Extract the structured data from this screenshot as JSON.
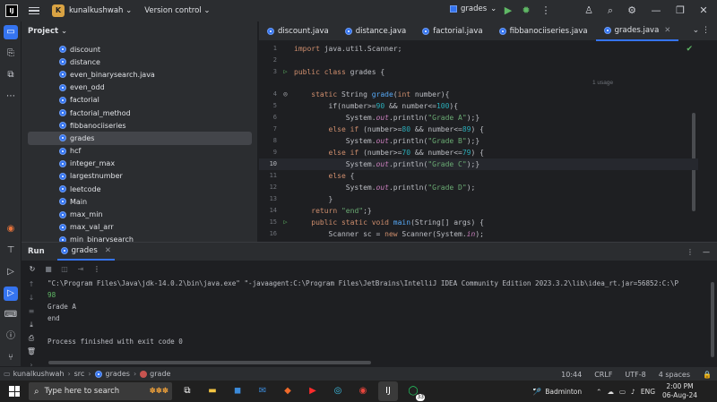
{
  "titlebar": {
    "app_logo": "IJ",
    "project_badge": "K",
    "project_name": "kunalkushwah",
    "version_control": "Version control",
    "run_config": "grades",
    "icons": [
      "menu-icon",
      "run-icon",
      "debug-icon",
      "more-icon",
      "add-user-icon",
      "search-icon",
      "settings-icon",
      "minimize-icon",
      "restore-icon",
      "close-icon"
    ]
  },
  "project": {
    "title": "Project",
    "items": [
      "discount",
      "distance",
      "even_binarysearch.java",
      "even_odd",
      "factorial",
      "factorial_method",
      "fibbanociiseries",
      "grades",
      "hcf",
      "integer_max",
      "largestnumber",
      "leetcode",
      "Main",
      "max_min",
      "max_val_arr",
      "min_binarysearch"
    ],
    "selected_index": 7
  },
  "tabs": [
    {
      "label": "discount.java"
    },
    {
      "label": "distance.java"
    },
    {
      "label": "factorial.java"
    },
    {
      "label": "fibbanociiseries.java"
    },
    {
      "label": "grades.java",
      "active": true
    }
  ],
  "editor": {
    "usage_hint": "1 usage",
    "line_numbers": [
      "1",
      "2",
      "3",
      "4",
      "5",
      "6",
      "7",
      "8",
      "9",
      "10",
      "11",
      "12",
      "13",
      "14",
      "15",
      "16"
    ],
    "current_line": 10,
    "lines": {
      "l1_kw": "import",
      "l1_rest": " java.util.Scanner;",
      "l3_kw": "public class",
      "l3_rest": " grades {",
      "l4_kw": "    static",
      "l4_type": " String ",
      "l4_fn": "grade",
      "l4_p1": "(",
      "l4_kw2": "int",
      "l4_p2": " number){",
      "if1": "        if(number>=",
      "if1_n1": "90",
      "if1_mid": " && number<=",
      "if1_n2": "100",
      "if1_end": "){",
      "print_pre": "            System.",
      "print_out": "out",
      "print_mid": ".println(",
      "gradeA": "\"Grade A\"",
      "gradeB": "\"Grade B\"",
      "gradeC": "\"Grade C\"",
      "gradeD": "\"Grade D\"",
      "print_end": ");}",
      "print_end2": ");",
      "elif_kw": "        else if",
      "elif2_a": " (number>=",
      "n80": "80",
      "mid": " && number<=",
      "n89": "89",
      "n70": "70",
      "n79": "79",
      "elif_end": ") {",
      "else_kw": "        else",
      "else_end": " {",
      "close_brace": "        }",
      "ret_kw": "    return",
      "ret_str": " \"end\"",
      "ret_end": ";}",
      "main_kw": "    public static void",
      "main_fn": " main",
      "main_rest": "(String[] args) {",
      "scan_pre": "        Scanner sc = ",
      "scan_kw": "new",
      "scan_rest": " Scanner(System.",
      "scan_in": "in",
      "scan_end": ");"
    }
  },
  "run": {
    "title": "Run",
    "tab": "grades",
    "console": [
      "\"C:\\Program Files\\Java\\jdk-14.0.2\\bin\\java.exe\" \"-javaagent:C:\\Program Files\\JetBrains\\IntelliJ IDEA Community Edition 2023.3.2\\lib\\idea_rt.jar=56852:C:\\P",
      "98",
      "Grade A",
      "end",
      "",
      "Process finished with exit code 0"
    ]
  },
  "statusbar": {
    "breadcrumb": [
      "kunalkushwah",
      "src",
      "grades",
      "grade"
    ],
    "position": "10:44",
    "line_sep": "CRLF",
    "encoding": "UTF-8",
    "indent": "4 spaces"
  },
  "taskbar": {
    "search_placeholder": "Type here to search",
    "weather": "Badminton",
    "lang": "ENG",
    "time": "2:00 PM",
    "date": "06-Aug-24",
    "notif_badge": "33"
  },
  "colors": {
    "accent": "#3574f0",
    "project_badge": "#d9a343",
    "run_green": "#5fb865"
  }
}
